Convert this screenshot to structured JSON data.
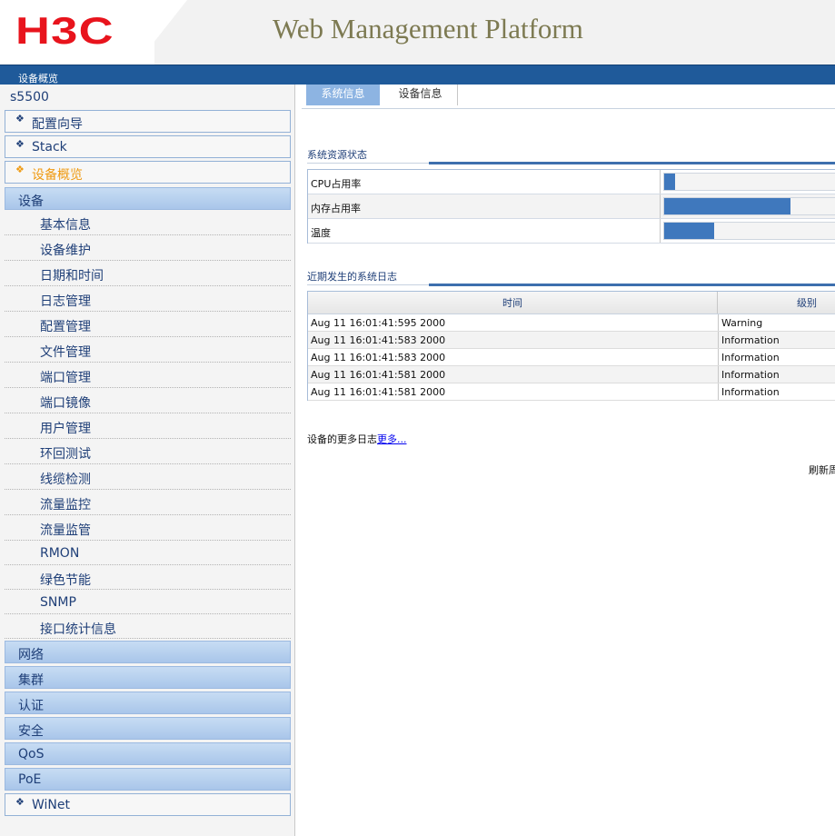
{
  "header": {
    "logo": "H3C",
    "title": "Web Management Platform"
  },
  "bluebar": {
    "title": "设备概览"
  },
  "sidebar": {
    "device": "s5500",
    "top_items": [
      {
        "label": "配置向导",
        "icon": "diamond-icon"
      },
      {
        "label": "Stack",
        "icon": "diamond-icon"
      },
      {
        "label": "设备概览",
        "icon": "diamond-icon",
        "active": true
      }
    ],
    "section_device": "设备",
    "sub_items": [
      "基本信息",
      "设备维护",
      "日期和时间",
      "日志管理",
      "配置管理",
      "文件管理",
      "端口管理",
      "端口镜像",
      "用户管理",
      "环回测试",
      "线缆检测",
      "流量监控",
      "流量监管",
      "RMON",
      "绿色节能",
      "SNMP",
      "接口统计信息"
    ],
    "sections": [
      "网络",
      "集群",
      "认证",
      "安全",
      "QoS",
      "PoE"
    ],
    "bottom_item": {
      "label": "WiNet",
      "icon": "diamond-icon"
    }
  },
  "tabs": {
    "sysinfo": "系统信息",
    "devinfo": "设备信息"
  },
  "resources": {
    "title": "系统资源状态",
    "rows": [
      {
        "label": "CPU占用率",
        "fill": 0.06
      },
      {
        "label": "内存占用率",
        "fill": 0.7
      },
      {
        "label": "温度",
        "fill": 0.28
      }
    ]
  },
  "logs": {
    "title": "近期发生的系统日志",
    "col_time": "时间",
    "col_level": "级别",
    "rows": [
      {
        "time": "Aug 11 16:01:41:595 2000",
        "level": "Warning"
      },
      {
        "time": "Aug 11 16:01:41:583 2000",
        "level": "Information"
      },
      {
        "time": "Aug 11 16:01:41:583 2000",
        "level": "Information"
      },
      {
        "time": "Aug 11 16:01:41:581 2000",
        "level": "Information"
      },
      {
        "time": "Aug 11 16:01:41:581 2000",
        "level": "Information"
      }
    ]
  },
  "more_logs": {
    "prefix": "设备的更多日志",
    "link": "更多..."
  },
  "refresh": "刷新周"
}
